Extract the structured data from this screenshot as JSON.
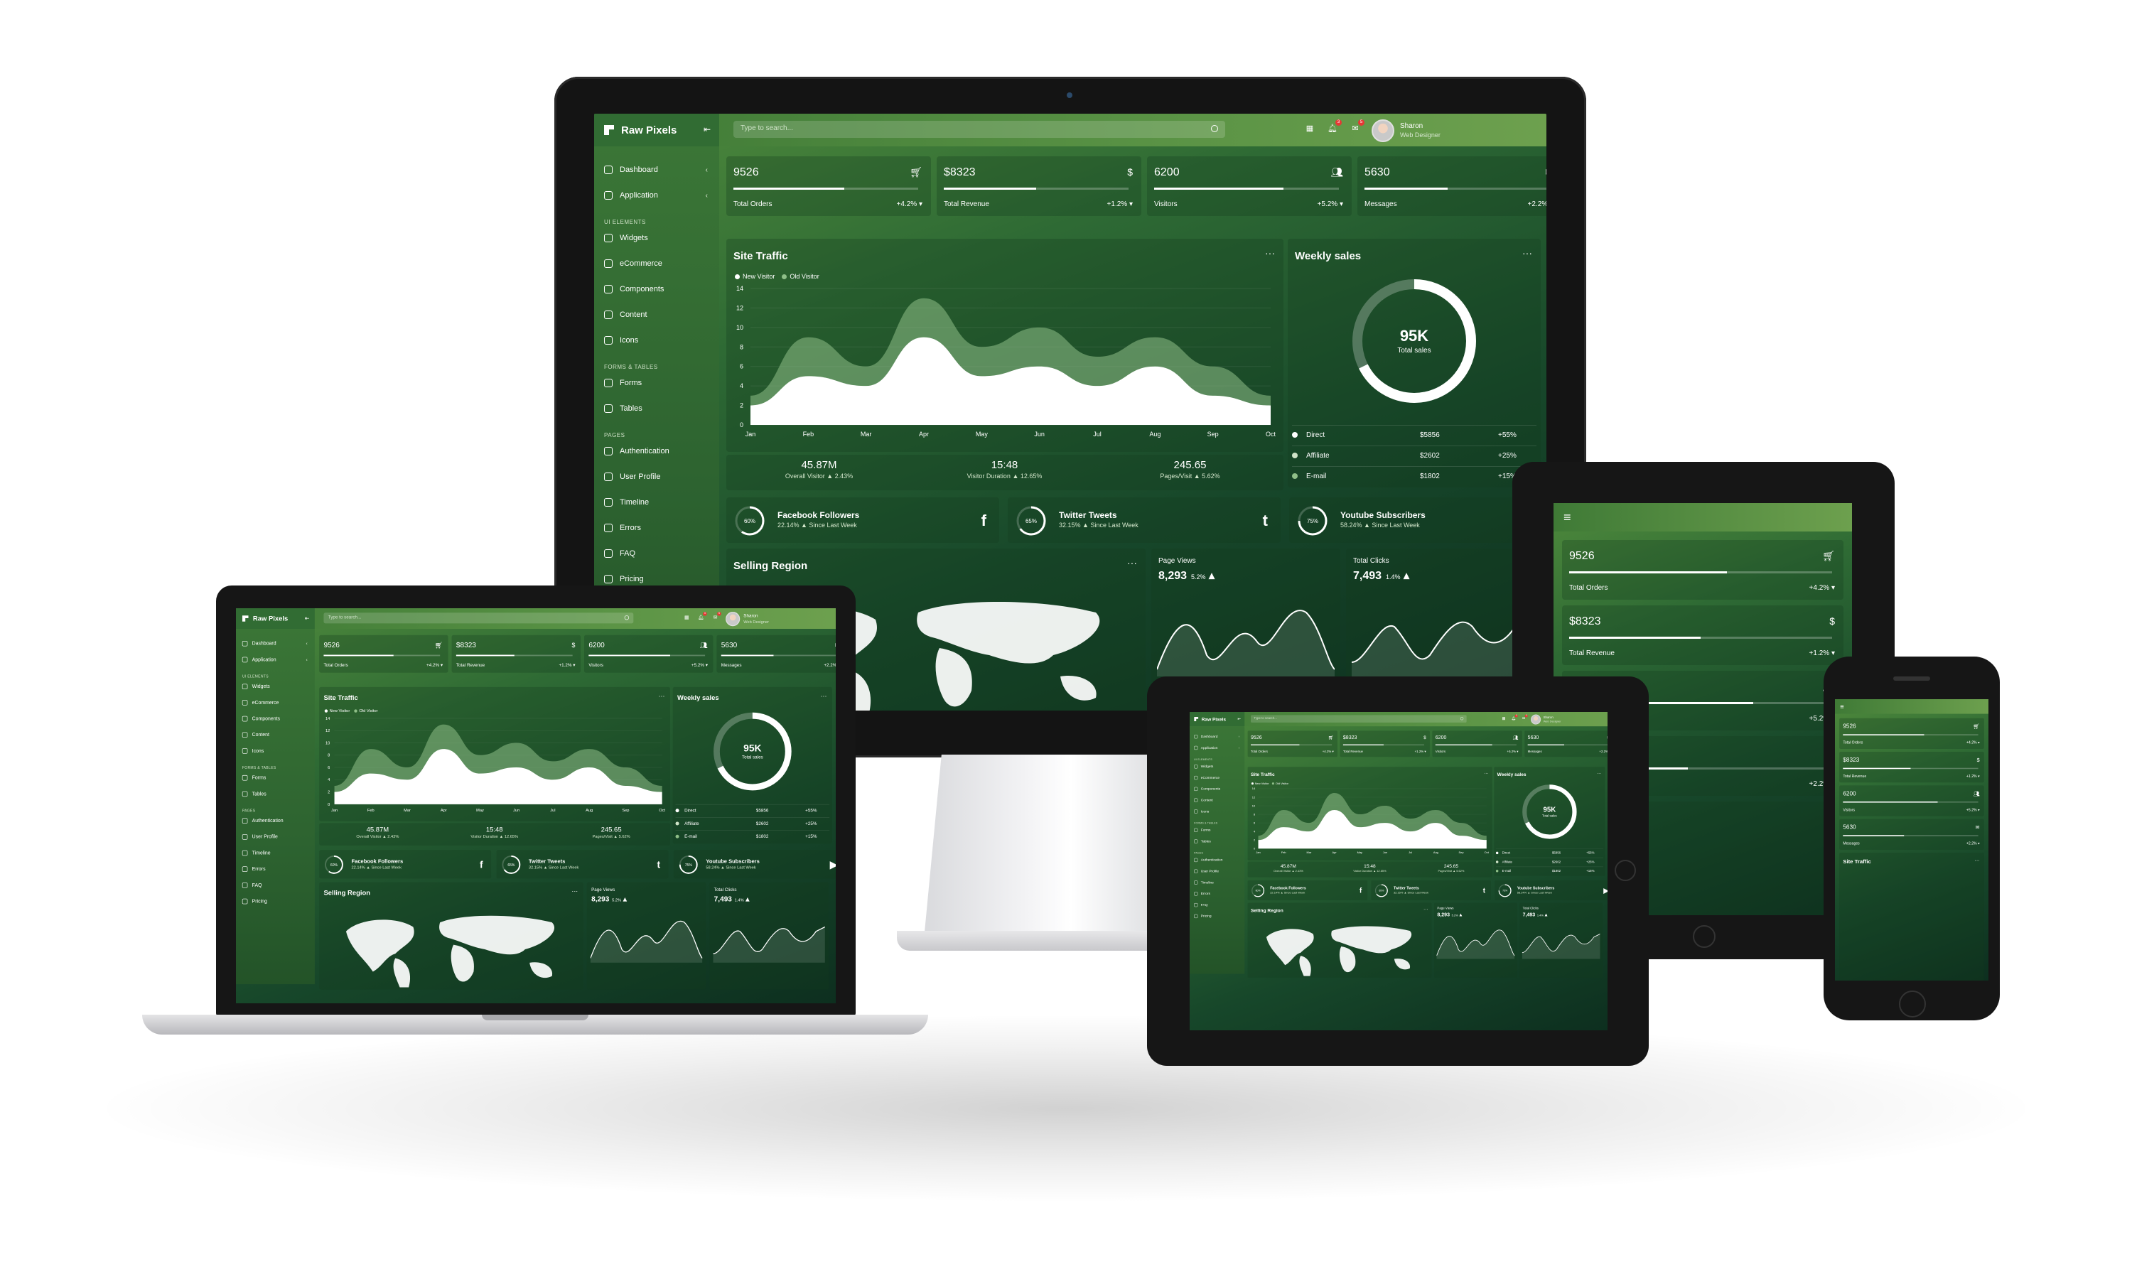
{
  "brand": {
    "name": "Raw Pixels"
  },
  "search": {
    "placeholder": "Type to search..."
  },
  "user": {
    "name": "Sharon",
    "role": "Web Designer"
  },
  "notifications": {
    "bell_count": "3",
    "chat_count": "5"
  },
  "sidebar": {
    "items": [
      {
        "label": "Dashboard",
        "icon": "home-icon"
      },
      {
        "label": "Application",
        "icon": "grid-icon"
      }
    ],
    "sections": [
      {
        "heading": "UI ELEMENTS",
        "items": [
          "Widgets",
          "eCommerce",
          "Components",
          "Content",
          "Icons"
        ]
      },
      {
        "heading": "FORMS & TABLES",
        "items": [
          "Forms",
          "Tables"
        ]
      },
      {
        "heading": "PAGES",
        "items": [
          "Authentication",
          "User Profile",
          "Timeline",
          "Errors",
          "FAQ",
          "Pricing"
        ]
      }
    ]
  },
  "stats": [
    {
      "value": "9526",
      "label": "Total Orders",
      "change": "+4.2%",
      "icon": "cart-icon",
      "progress": 0.6
    },
    {
      "value": "$8323",
      "label": "Total Revenue",
      "change": "+1.2%",
      "icon": "dollar-icon",
      "progress": 0.5
    },
    {
      "value": "6200",
      "label": "Visitors",
      "change": "+5.2%",
      "icon": "users-icon",
      "progress": 0.7
    },
    {
      "value": "5630",
      "label": "Messages",
      "change": "+2.2%",
      "icon": "mail-icon",
      "progress": 0.45
    }
  ],
  "site_traffic": {
    "title": "Site Traffic",
    "legend": [
      "New Visitor",
      "Old Visitor"
    ],
    "summary": [
      {
        "value": "45.87M",
        "label": "Overall Visitor",
        "change": "2.43%"
      },
      {
        "value": "15:48",
        "label": "Visitor Duration",
        "change": "12.65%"
      },
      {
        "value": "245.65",
        "label": "Pages/Visit",
        "change": "5.62%"
      }
    ]
  },
  "weekly_sales": {
    "title": "Weekly sales",
    "center_value": "95K",
    "center_label": "Total sales",
    "rows": [
      {
        "name": "Direct",
        "value": "$5856",
        "pct": "+55%"
      },
      {
        "name": "Affiliate",
        "value": "$2602",
        "pct": "+25%"
      },
      {
        "name": "E-mail",
        "value": "$1802",
        "pct": "+15%"
      }
    ]
  },
  "social": [
    {
      "percent": "60%",
      "title": "Facebook Followers",
      "sub": "22.14% ▲ Since Last Week",
      "logo": "f",
      "icon": "facebook-icon"
    },
    {
      "percent": "65%",
      "title": "Twitter Tweets",
      "sub": "32.15% ▲ Since Last Week",
      "logo": "t",
      "icon": "twitter-icon"
    },
    {
      "percent": "75%",
      "title": "Youtube Subscribers",
      "sub": "58.24% ▲ Since Last Week",
      "logo": "▶",
      "icon": "youtube-icon"
    }
  ],
  "selling_region": {
    "title": "Selling Region"
  },
  "page_views": {
    "label": "Page Views",
    "value": "8,293",
    "change": "5.2%"
  },
  "total_clicks": {
    "label": "Total Clicks",
    "value": "7,493",
    "change": "1.4%"
  },
  "chart_data": {
    "type": "area",
    "title": "Site Traffic",
    "categories": [
      "Jan",
      "Feb",
      "Mar",
      "Apr",
      "May",
      "Jun",
      "Jul",
      "Aug",
      "Sep",
      "Oct"
    ],
    "ylim": [
      0,
      14
    ],
    "yticks": [
      0,
      2,
      4,
      6,
      8,
      10,
      12,
      14
    ],
    "series": [
      {
        "name": "New Visitor",
        "values": [
          2,
          5,
          4,
          9,
          5,
          6,
          4,
          6,
          3,
          2
        ]
      },
      {
        "name": "Old Visitor",
        "values": [
          3,
          9,
          6,
          13,
          8,
          10,
          7,
          9,
          6,
          3
        ]
      }
    ],
    "colors": {
      "new": "#ffffff",
      "old": "#8fbf88"
    }
  },
  "colors": {
    "accent": "#4f8a3c",
    "sidebar": "#316c33",
    "badge": "#e53935"
  }
}
